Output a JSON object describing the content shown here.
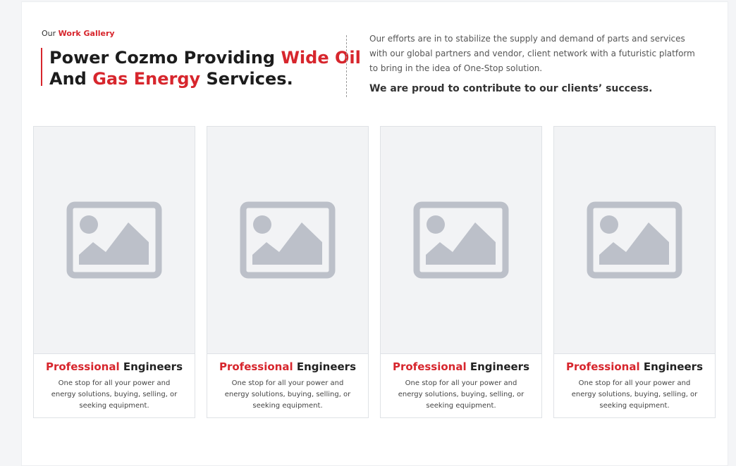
{
  "header": {
    "eyebrow_prefix": "Our",
    "eyebrow_accent": "Work Gallery",
    "title_part1": "Power Cozmo Providing ",
    "title_red1": "Wide Oil",
    "title_part2": "And ",
    "title_red2": "Gas Energy",
    "title_part3": " Services.",
    "intro": "Our efforts are in to stabilize the supply and demand of parts and services with our global partners and vendor, client network with a futuristic platform to bring in the idea of One-Stop solution.",
    "tagline": "We are proud to contribute to our clients’ success."
  },
  "colors": {
    "accent": "#d7262d",
    "placeholder_icon": "#bcc0c9",
    "card_bg": "#f2f3f5"
  },
  "cards": [
    {
      "icon": "image-placeholder-icon",
      "title_red": "Professional",
      "title_rest": " Engineers",
      "description": "One stop for all your power and energy solutions, buying, selling, or seeking equipment."
    },
    {
      "icon": "image-placeholder-icon",
      "title_red": "Professional",
      "title_rest": " Engineers",
      "description": "One stop for all your power and energy solutions, buying, selling, or seeking equipment."
    },
    {
      "icon": "image-placeholder-icon",
      "title_red": "Professional",
      "title_rest": " Engineers",
      "description": "One stop for all your power and energy solutions, buying, selling, or seeking equipment."
    },
    {
      "icon": "image-placeholder-icon",
      "title_red": "Professional",
      "title_rest": " Engineers",
      "description": "One stop for all your power and energy solutions, buying, selling, or seeking equipment."
    }
  ]
}
